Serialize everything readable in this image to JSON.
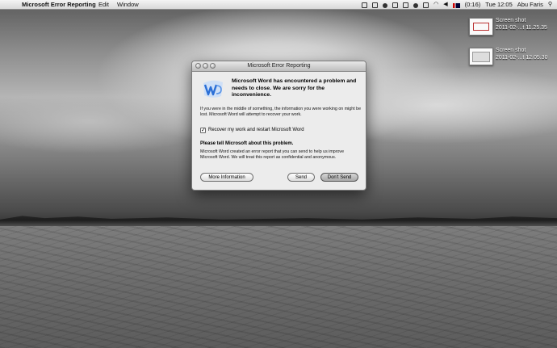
{
  "menubar": {
    "apple_icon": "",
    "app_name": "Microsoft Error Reporting",
    "items": [
      "Edit",
      "Window"
    ],
    "battery": "(0:16)",
    "clock": "Tue 12:05",
    "user": "Abu Faris"
  },
  "desktop": {
    "icons": [
      {
        "label_line1": "Screen shot",
        "label_line2": "2011-02-...t 11.25.35"
      },
      {
        "label_line1": "Screen shot",
        "label_line2": "2011-02-...t 12.05.30"
      }
    ]
  },
  "dialog": {
    "title": "Microsoft Error Reporting",
    "headline": "Microsoft Word has encountered a problem and needs to close. We are sorry for the inconvenience.",
    "body": "If you were in the middle of something, the information you were working on might be lost. Microsoft Word will attempt to recover your work.",
    "checkbox_mark": "✓",
    "checkbox_label": "Recover my work and restart Microsoft Word",
    "tell_heading": "Please tell Microsoft about this problem.",
    "report_text": "Microsoft Word created an error report that you can send to help us improve Microsoft Word. We will treat this report as confidential and anonymous.",
    "buttons": {
      "more_info": "More Information",
      "send": "Send",
      "dont_send": "Don't Send"
    }
  },
  "colors": {
    "word_blue": "#2b6fd6",
    "dialog_bg": "#ececec"
  }
}
